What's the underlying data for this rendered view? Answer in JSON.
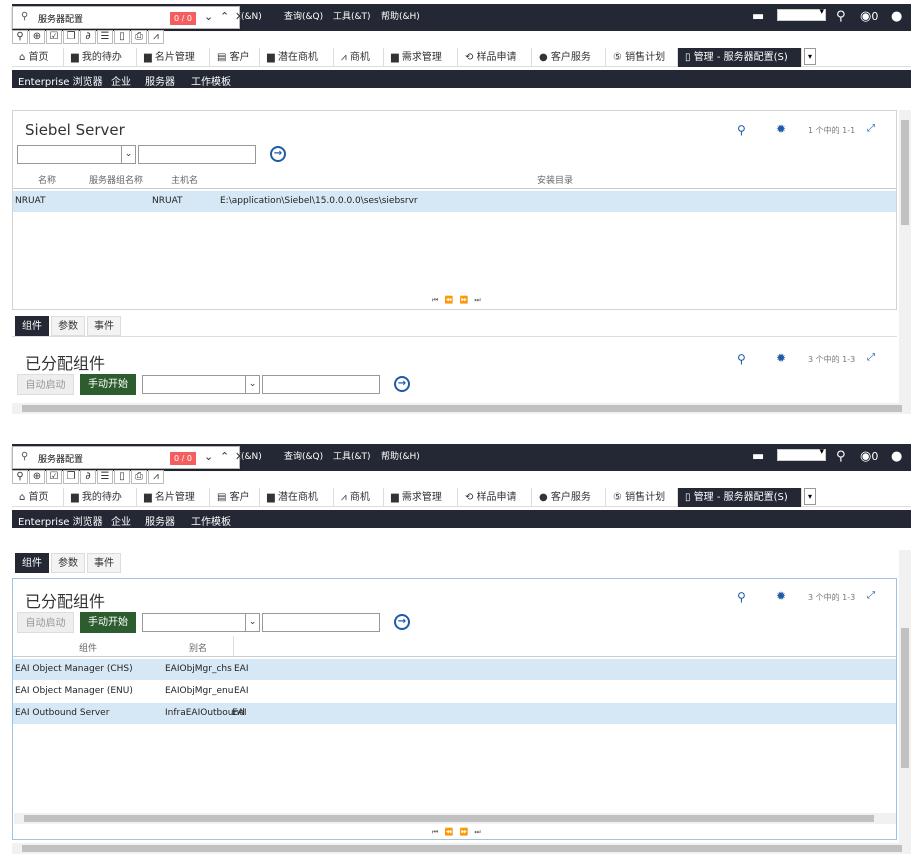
{
  "find": {
    "query": "服务器配置",
    "count": "0 / 0"
  },
  "topmenu": [
    "览(&N)",
    "查询(&Q)",
    "工具(&T)",
    "帮助(&H)"
  ],
  "top_count": "0",
  "tabs": [
    "首页",
    "我的待办",
    "名片管理",
    "客户",
    "潜在商机",
    "商机",
    "需求管理",
    "样品申请",
    "客户服务",
    "销售计划",
    "管理 - 服务器配置(S)"
  ],
  "subnav": [
    "Enterprise 浏览器",
    "企业",
    "服务器",
    "工作模板"
  ],
  "server_applet": {
    "title": "Siebel Server",
    "paging": "1 个中的 1-1",
    "columns": [
      "名称",
      "服务器组名称",
      "主机名",
      "安装目录"
    ],
    "rows": [
      {
        "name": "NRUAT",
        "group": "",
        "host": "NRUAT",
        "dir": "E:\\application\\Siebel\\15.0.0.0.0\\ses\\siebsrvr"
      }
    ]
  },
  "child_tabs": [
    "组件",
    "参数",
    "事件"
  ],
  "component_applet": {
    "title": "已分配组件",
    "paging": "3 个中的 1-3",
    "btn_auto": "自动启动",
    "btn_manual": "手动开始",
    "columns": [
      "组件",
      "别名"
    ],
    "rows": [
      {
        "component": "EAI Object Manager (CHS)",
        "alias": "EAIObjMgr_chs",
        "group": "EAI"
      },
      {
        "component": "EAI Object Manager (ENU)",
        "alias": "EAIObjMgr_enu",
        "group": "EAI"
      },
      {
        "component": "EAI Outbound Server",
        "alias": "InfraEAIOutbound",
        "group": "EAI"
      }
    ]
  },
  "pager_symbols": "⏮ ⏪ ⏩ ⏭"
}
